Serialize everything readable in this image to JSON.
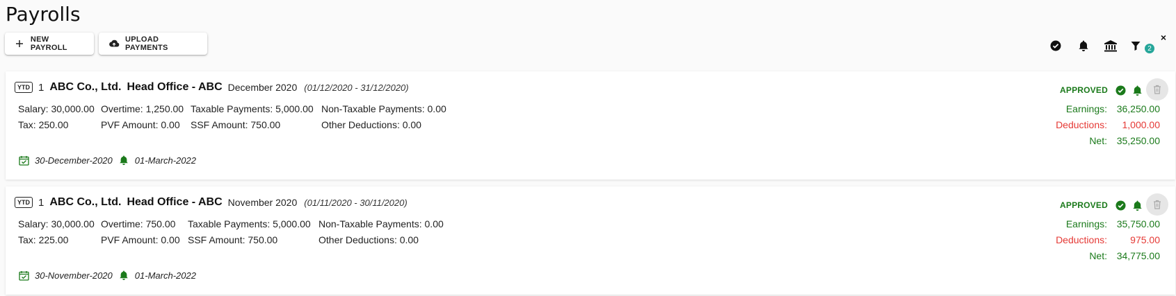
{
  "page": {
    "title": "Payrolls"
  },
  "toolbar": {
    "new_payroll_label": "NEW PAYROLL",
    "upload_payments_label": "UPLOAD PAYMENTS",
    "filter_count": "2",
    "clear_filter": "×"
  },
  "colors": {
    "approved": "#1b7a1b",
    "deduction": "#e53935",
    "badge": "#26a69a"
  },
  "payrolls": [
    {
      "ytd": "YTD",
      "seq": "1",
      "company": "ABC Co., Ltd.",
      "office": "Head Office - ABC",
      "period": "December 2020",
      "range": "(01/12/2020 - 31/12/2020)",
      "status": "APPROVED",
      "fields": {
        "salary": "Salary: 30,000.00",
        "overtime": "Overtime: 1,250.00",
        "taxable": "Taxable Payments: 5,000.00",
        "non_taxable": "Non-Taxable Payments: 0.00",
        "tax": "Tax: 250.00",
        "pvf": "PVF Amount: 0.00",
        "ssf": "SSF Amount: 750.00",
        "other_deductions": "Other Deductions: 0.00"
      },
      "totals": {
        "earnings_label": "Earnings:",
        "earnings": "36,250.00",
        "deductions_label": "Deductions:",
        "deductions": "1,000.00",
        "net_label": "Net:",
        "net": "35,250.00"
      },
      "pay_date": "30-December-2020",
      "notify_date": "01-March-2022"
    },
    {
      "ytd": "YTD",
      "seq": "1",
      "company": "ABC Co., Ltd.",
      "office": "Head Office - ABC",
      "period": "November 2020",
      "range": "(01/11/2020 - 30/11/2020)",
      "status": "APPROVED",
      "fields": {
        "salary": "Salary: 30,000.00",
        "overtime": "Overtime: 750.00",
        "taxable": "Taxable Payments: 5,000.00",
        "non_taxable": "Non-Taxable Payments: 0.00",
        "tax": "Tax: 225.00",
        "pvf": "PVF Amount: 0.00",
        "ssf": "SSF Amount: 750.00",
        "other_deductions": "Other Deductions: 0.00"
      },
      "totals": {
        "earnings_label": "Earnings:",
        "earnings": "35,750.00",
        "deductions_label": "Deductions:",
        "deductions": "975.00",
        "net_label": "Net:",
        "net": "34,775.00"
      },
      "pay_date": "30-November-2020",
      "notify_date": "01-March-2022"
    }
  ]
}
